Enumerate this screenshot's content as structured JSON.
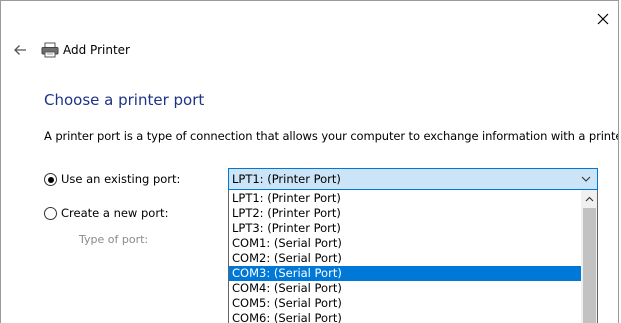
{
  "window": {
    "close_icon": "close-icon"
  },
  "header": {
    "back_icon": "back-arrow-icon",
    "printer_icon": "printer-icon",
    "title": "Add Printer"
  },
  "page": {
    "title": "Choose a printer port",
    "description": "A printer port is a type of connection that allows your computer to exchange information with a printer."
  },
  "options": {
    "existing_port_label": "Use an existing port:",
    "existing_port_checked": true,
    "new_port_label": "Create a new port:",
    "new_port_checked": false,
    "type_of_port_label": "Type of port:"
  },
  "port_combo": {
    "value": "LPT1: (Printer Port)",
    "items": [
      "LPT1: (Printer Port)",
      "LPT2: (Printer Port)",
      "LPT3: (Printer Port)",
      "COM1: (Serial Port)",
      "COM2: (Serial Port)",
      "COM3: (Serial Port)",
      "COM4: (Serial Port)",
      "COM5: (Serial Port)",
      "COM6: (Serial Port)"
    ],
    "highlighted": "COM3: (Serial Port)"
  },
  "colors": {
    "accent": "#0078d7",
    "title_blue": "#1e3287",
    "combo_bg": "#cce4f7"
  }
}
